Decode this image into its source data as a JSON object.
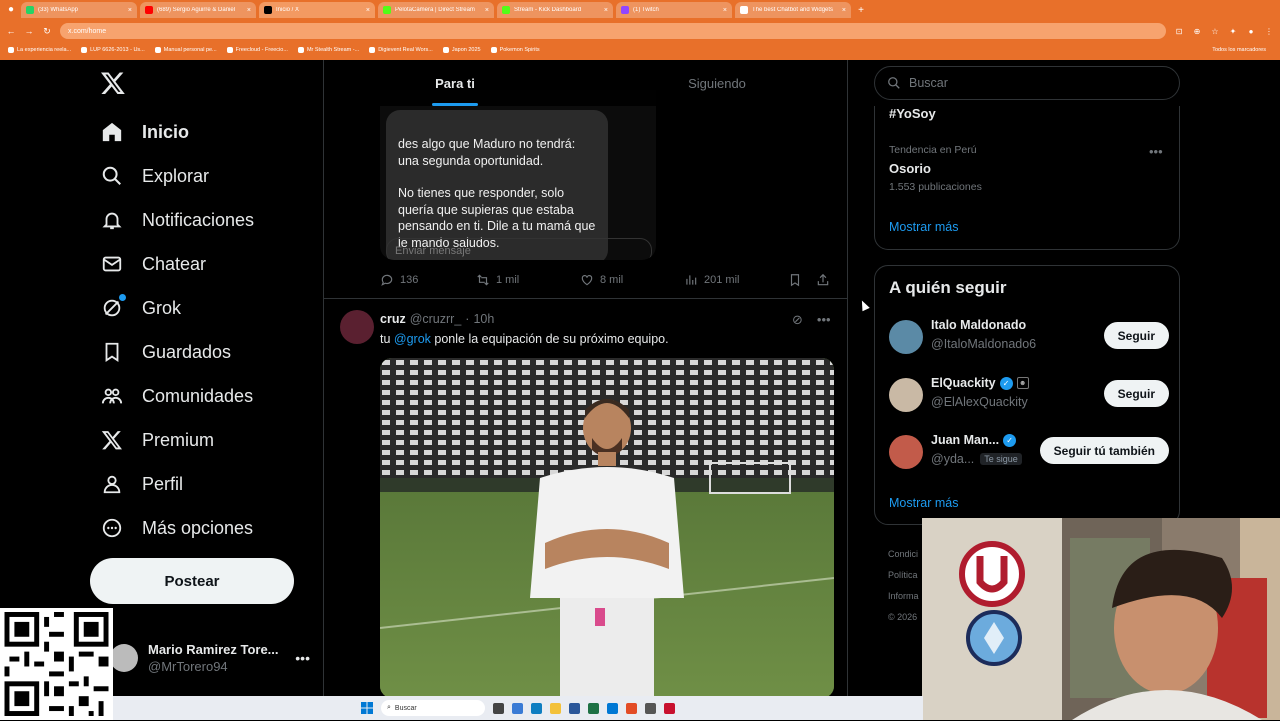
{
  "browser": {
    "tabs": [
      {
        "label": "(33) WhatsApp",
        "color": "#25d366",
        "active": false
      },
      {
        "label": "(689) Sergio Aguirre & Daniel",
        "color": "#ff0000",
        "active": false
      },
      {
        "label": "Inicio / X",
        "color": "#000000",
        "active": true
      },
      {
        "label": "PelotaCamera | Direct Stream",
        "color": "#53fc18",
        "active": false
      },
      {
        "label": "Stream - Kick Dashboard",
        "color": "#53fc18",
        "active": false
      },
      {
        "label": "(1) Twitch",
        "color": "#9146ff",
        "active": false
      },
      {
        "label": "The best Chatbot and Widgets",
        "color": "#ffffff",
        "active": false
      }
    ],
    "url": "x.com/home",
    "bookmarks": [
      "La experiencia reela...",
      "LUP 6626-2013 - Us...",
      "Manual personal pe...",
      "Freecloud - Freecio...",
      "Mr Stealth Stream -...",
      "Digievent Real Wors...",
      "Japon 2025",
      "Pokemon Spirits"
    ],
    "bookmarks_right": "Todos los marcadores"
  },
  "nav": {
    "items": [
      {
        "label": "Inicio",
        "icon": "home-icon",
        "active": true
      },
      {
        "label": "Explorar",
        "icon": "search-icon"
      },
      {
        "label": "Notificaciones",
        "icon": "bell-icon"
      },
      {
        "label": "Chatear",
        "icon": "mail-icon"
      },
      {
        "label": "Grok",
        "icon": "grok-icon"
      },
      {
        "label": "Guardados",
        "icon": "bookmark-icon"
      },
      {
        "label": "Comunidades",
        "icon": "communities-icon"
      },
      {
        "label": "Premium",
        "icon": "x-premium-icon"
      },
      {
        "label": "Perfil",
        "icon": "person-icon"
      },
      {
        "label": "Más opciones",
        "icon": "more-circle-icon"
      }
    ],
    "post_label": "Postear",
    "account": {
      "name": "Mario Ramirez Tore...",
      "handle": "@MrTorero94"
    }
  },
  "feed": {
    "tabs": [
      "Para ti",
      "Siguiendo"
    ],
    "tweet1": {
      "message_line1": "des algo que Maduro no tendrá: una segunda oportunidad.",
      "message_line2": "No tienes que responder, solo quería que supieras que estaba pensando en ti. Dile a tu mamá que le mando saludos.",
      "input_placeholder": "Enviar mensaje",
      "replies": "136",
      "reposts": "1 mil",
      "likes": "8 mil",
      "views": "201 mil"
    },
    "tweet2": {
      "name": "cruz",
      "handle": "@cruzrr_",
      "dot": "·",
      "time": "10h",
      "text_pre": "tu ",
      "mention": "@grok",
      "text_post": " ponle la equipación de su próximo equipo."
    }
  },
  "right": {
    "search_placeholder": "Buscar",
    "trends": {
      "top": "#YoSoy",
      "context": "Tendencia en Perú",
      "name": "Osorio",
      "count": "1.553 publicaciones",
      "show_more": "Mostrar más"
    },
    "who_to_follow": {
      "title": "A quién seguir",
      "people": [
        {
          "name": "Italo Maldonado",
          "handle": "@ItaloMaldonado6",
          "button": "Seguir",
          "verified": false
        },
        {
          "name": "ElQuackity",
          "handle": "@ElAlexQuackity",
          "button": "Seguir",
          "verified": true
        },
        {
          "name": "Juan Man...",
          "handle": "@yda...",
          "button": "Seguir tú también",
          "verified": true,
          "follows_you": "Te sigue"
        }
      ],
      "show_more": "Mostrar más"
    },
    "footer": [
      "Condici",
      "Política",
      "Informa",
      "© 2026"
    ]
  },
  "taskbar": {
    "search": "Buscar"
  }
}
